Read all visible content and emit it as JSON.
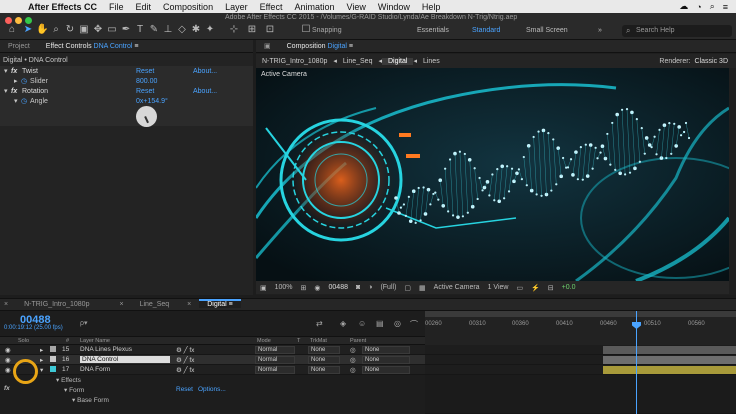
{
  "menubar": {
    "app_name": "After Effects CC",
    "items": [
      "File",
      "Edit",
      "Composition",
      "Layer",
      "Effect",
      "Animation",
      "View",
      "Window",
      "Help"
    ]
  },
  "window": {
    "title": "Adobe After Effects CC 2015 - /Volumes/G-RAID Studio/Lynda/Ae Breakdown N-Trig/Ntrig.aep"
  },
  "toolbar": {
    "snapping_label": "Snapping",
    "workspaces": [
      {
        "label": "Essentials",
        "active": false
      },
      {
        "label": "Standard",
        "active": true
      },
      {
        "label": "Small Screen",
        "active": false
      }
    ],
    "search_placeholder": "Search Help"
  },
  "left_panel": {
    "tabs": [
      {
        "label": "Project"
      },
      {
        "label": "Effect Controls",
        "target": "DNA Control"
      }
    ],
    "subtitle": "Digital • DNA Control",
    "effects": [
      {
        "name": "Twist",
        "reset": "Reset",
        "about": "About...",
        "params": [
          {
            "name": "Slider",
            "value": "800.00"
          }
        ]
      },
      {
        "name": "Rotation",
        "reset": "Reset",
        "about": "About...",
        "params": [
          {
            "name": "Angle",
            "value": "0x+154.9°"
          }
        ]
      }
    ]
  },
  "composition": {
    "tab_label": "Composition",
    "tab_target": "Digital",
    "breadcrumbs": [
      "N-TRIG_Intro_1080p",
      "Line_Seq",
      "Digital",
      "Lines"
    ],
    "active_crumb": "Digital",
    "renderer_label": "Renderer:",
    "renderer_value": "Classic 3D",
    "viewer_label": "Active Camera",
    "footer": {
      "zoom": "100%",
      "timecode": "00488",
      "resolution": "(Full)",
      "camera": "Active Camera",
      "views": "1 View",
      "exposure": "+0.0"
    }
  },
  "timeline": {
    "tabs": [
      {
        "label": "N-TRIG_Intro_1080p",
        "active": false
      },
      {
        "label": "Line_Seq",
        "active": false
      },
      {
        "label": "Digital",
        "active": true
      }
    ],
    "timecode": "00488",
    "fps": "0:00:19:12 (25.00 fps)",
    "search_placeholder": "ρ▾",
    "columns": {
      "solo": "Solo",
      "num": "#",
      "layer_name": "Layer Name",
      "mode": "Mode",
      "t": "T",
      "trkmat": "TrkMat",
      "parent": "Parent"
    },
    "ruler_ticks": [
      "00260",
      "00310",
      "00360",
      "00410",
      "00460",
      "00510",
      "00560"
    ],
    "layers": [
      {
        "num": "15",
        "name": "DNA Lines Plexus",
        "color": "#a6a6a6",
        "mode": "Normal",
        "trkmat": "None",
        "parent": "None"
      },
      {
        "num": "16",
        "name": "DNA Control",
        "color": "#c8c8c8",
        "mode": "Normal",
        "trkmat": "None",
        "parent": "None"
      },
      {
        "num": "17",
        "name": "DNA Form",
        "color": "#3ec9d6",
        "mode": "Normal",
        "trkmat": "None",
        "parent": "None"
      }
    ],
    "sub_rows": {
      "effects": "Effects",
      "form": "Form",
      "reset": "Reset",
      "options": "Options...",
      "base_form": "Base Form"
    }
  },
  "colors": {
    "accent": "#4aa3ff",
    "teal": "#3ec9d6",
    "bar_olive": "#a89a3a"
  }
}
